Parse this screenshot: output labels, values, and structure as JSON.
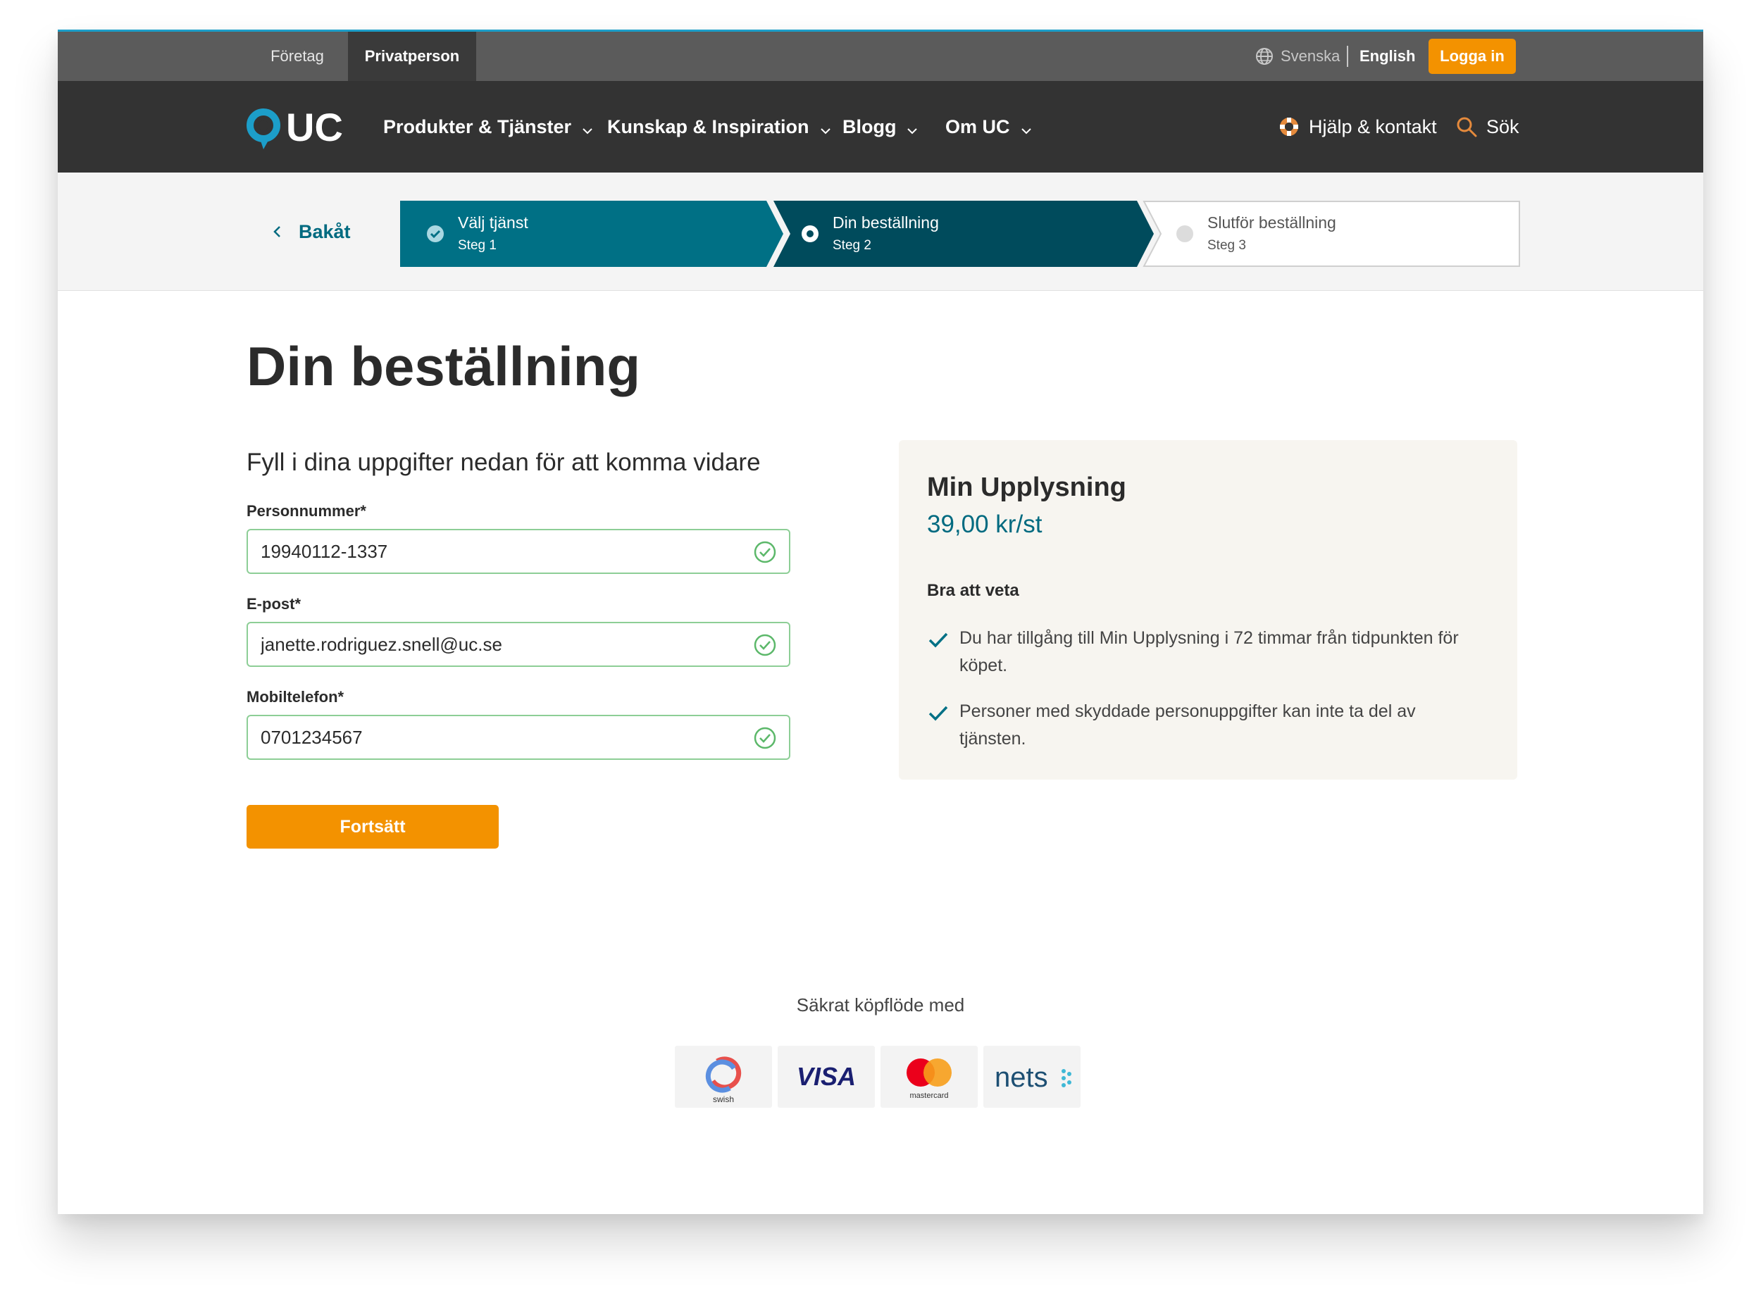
{
  "topbar": {
    "segments": [
      "Företag",
      "Privatperson"
    ],
    "active_segment": "Privatperson",
    "languages": [
      "Svenska",
      "English"
    ],
    "active_language": "English",
    "login_label": "Logga in"
  },
  "nav": {
    "brand": "UC",
    "items": [
      "Produkter & Tjänster",
      "Kunskap & Inspiration",
      "Blogg",
      "Om UC"
    ],
    "help_label": "Hjälp & kontakt",
    "search_label": "Sök"
  },
  "stepper": {
    "back_label": "Bakåt",
    "steps": [
      {
        "title": "Välj tjänst",
        "sub": "Steg 1",
        "state": "done"
      },
      {
        "title": "Din beställning",
        "sub": "Steg 2",
        "state": "current"
      },
      {
        "title": "Slutför beställning",
        "sub": "Steg 3",
        "state": "upcoming"
      }
    ]
  },
  "page": {
    "title": "Din beställning",
    "lead": "Fyll i dina uppgifter nedan för att komma vidare"
  },
  "form": {
    "personnummer_label": "Personnummer*",
    "personnummer_value": "19940112-1337",
    "email_label": "E-post*",
    "email_value": "janette.rodriguez.snell@uc.se",
    "mobile_label": "Mobiltelefon*",
    "mobile_value": "0701234567",
    "continue_label": "Fortsätt"
  },
  "summary": {
    "product": "Min Upplysning",
    "price": "39,00 kr/st",
    "good_to_know": "Bra att veta",
    "points": [
      "Du har tillgång till Min Upplysning i 72 timmar från tidpunkten för köpet.",
      "Personer med skyddade personuppgifter kan inte ta del av tjänsten."
    ]
  },
  "footer": {
    "secure_label": "Säkrat köpflöde med",
    "payment_methods": [
      "swish",
      "VISA",
      "mastercard",
      "nets"
    ]
  },
  "colors": {
    "topbar": "#5b5b5b",
    "nav": "#333333",
    "accent_orange": "#f39200",
    "brand_teal": "#006a80",
    "step_done": "#007085",
    "step_current": "#004b5c",
    "valid_green": "#5cb86a"
  }
}
